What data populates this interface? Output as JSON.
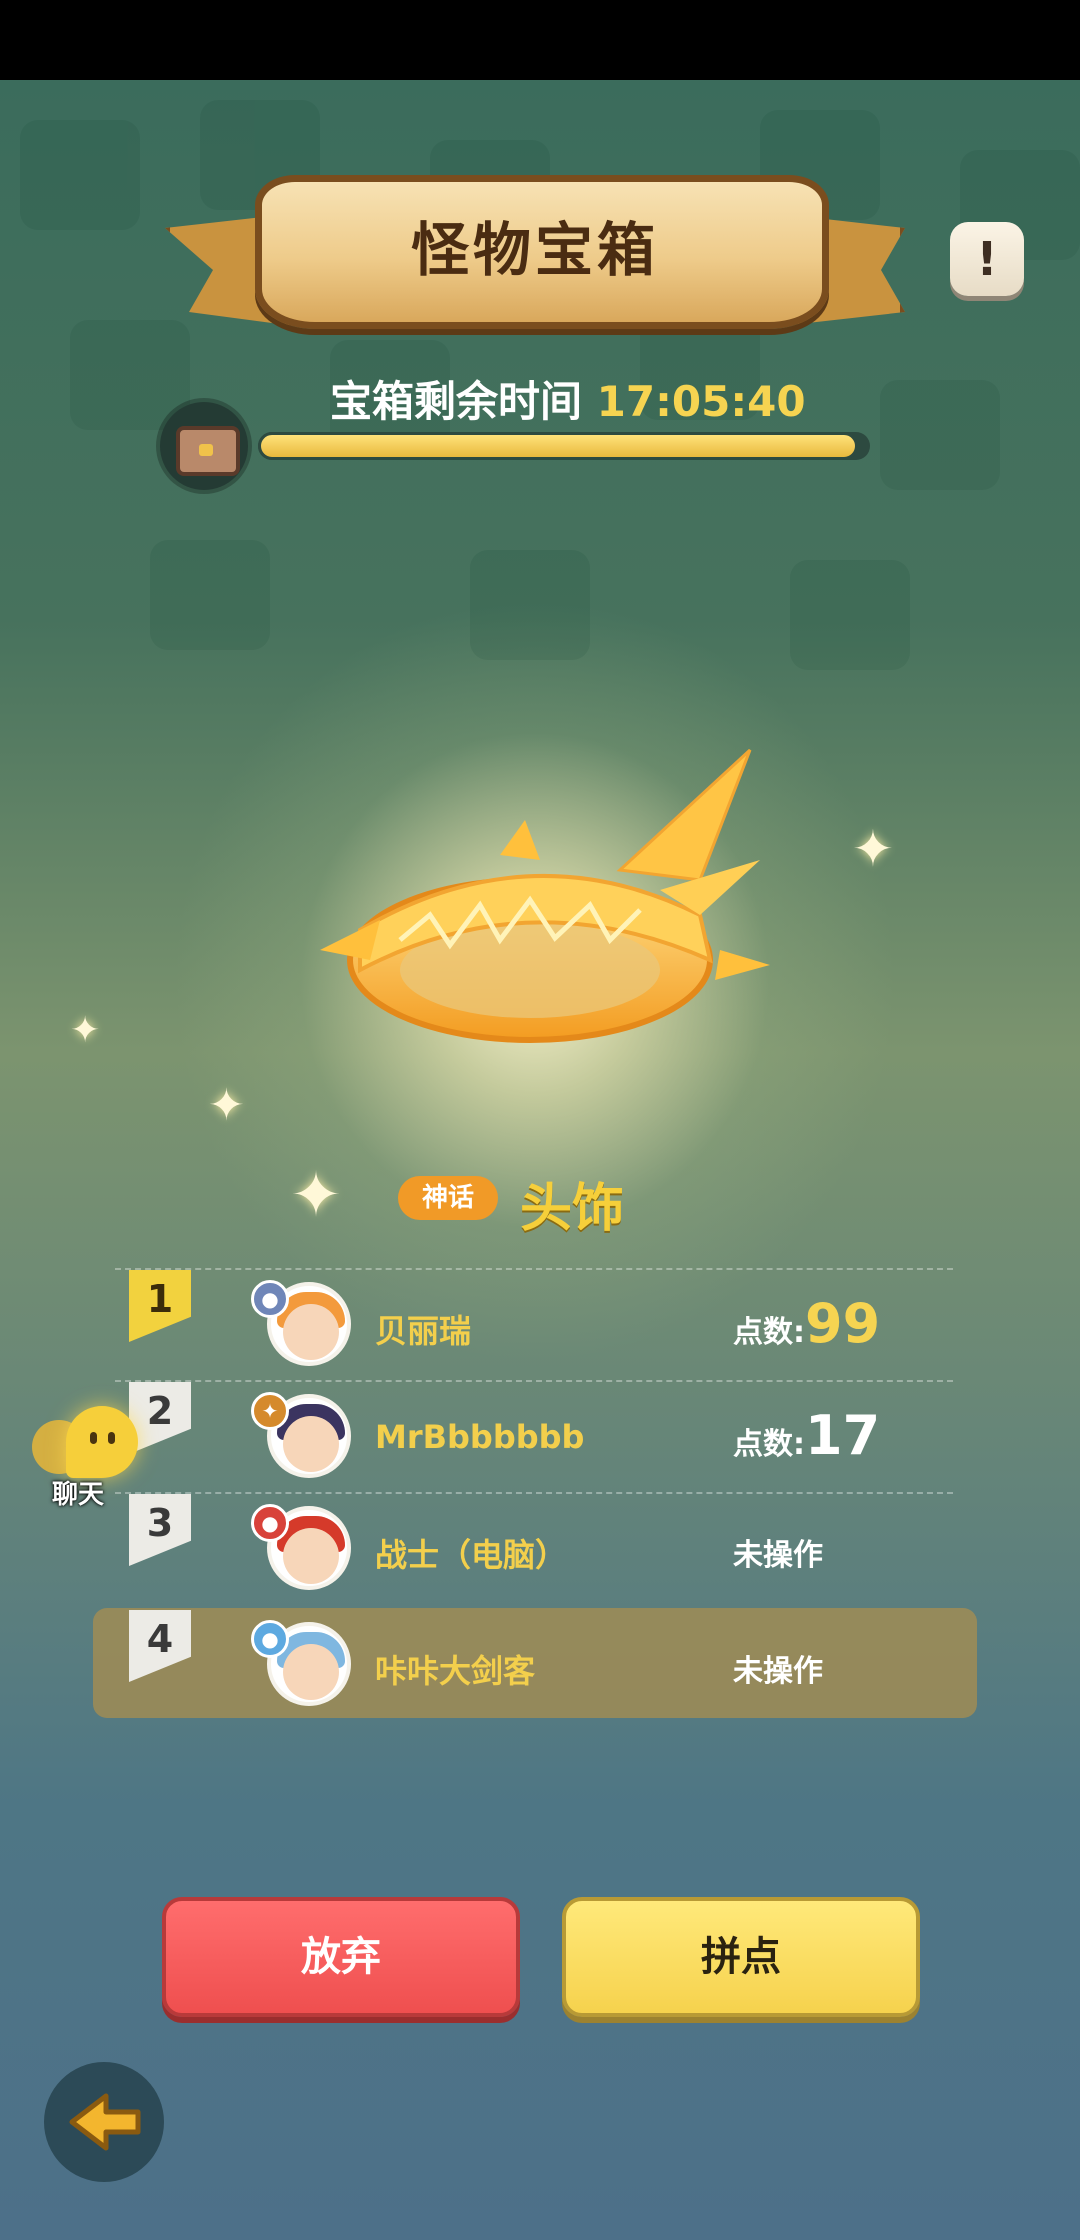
{
  "header": {
    "title": "怪物宝箱",
    "info_icon": "!"
  },
  "timer": {
    "label": "宝箱剩余时间",
    "time": "17:05:40",
    "progress": 0.98
  },
  "item": {
    "rarity": "神话",
    "name": "头饰"
  },
  "players": [
    {
      "rank": "1",
      "name": "贝丽瑞",
      "score_label": "点数:",
      "score": "99",
      "status": null
    },
    {
      "rank": "2",
      "name": "MrBbbbbbb",
      "score_label": "点数:",
      "score": "17",
      "status": null
    },
    {
      "rank": "3",
      "name": "战士（电脑）",
      "score_label": null,
      "score": null,
      "status": "未操作"
    },
    {
      "rank": "4",
      "name": "咔咔大剑客",
      "score_label": null,
      "score": null,
      "status": "未操作"
    }
  ],
  "chat": {
    "label": "聊天"
  },
  "buttons": {
    "give_up": "放弃",
    "roll": "拼点"
  },
  "colors": {
    "accent_gold": "#f6d451",
    "give_up": "#ef4f4f",
    "roll": "#f6d24d",
    "rarity_badge": "#f19a27"
  }
}
